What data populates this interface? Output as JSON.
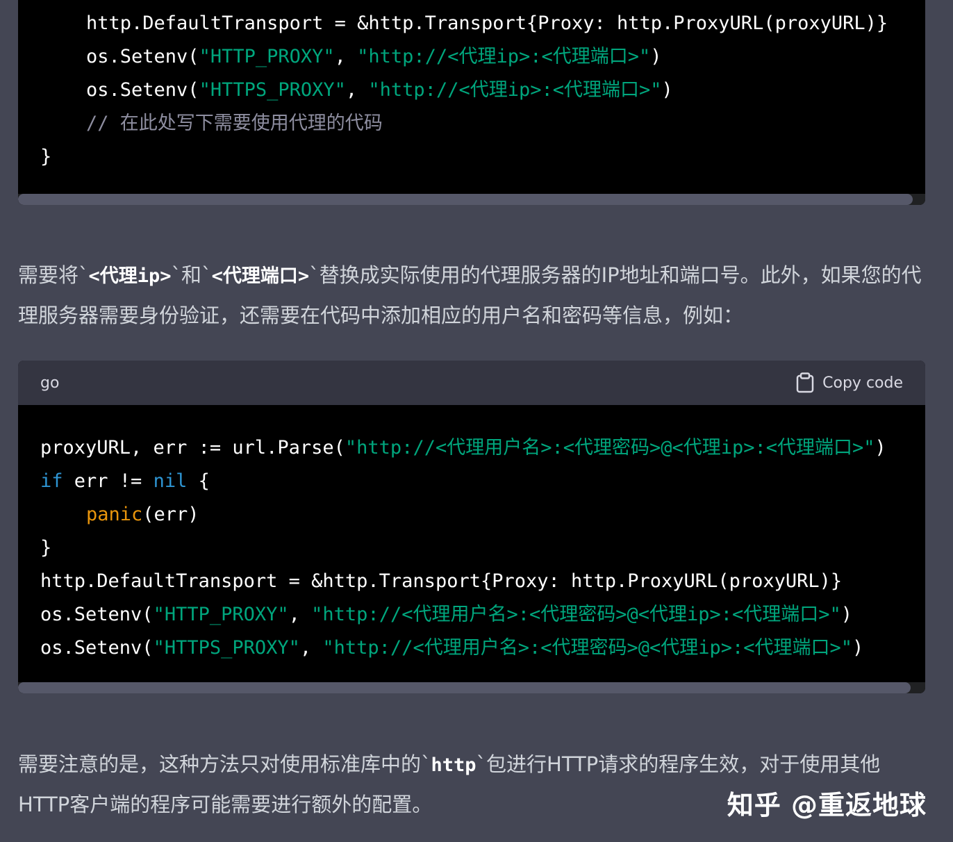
{
  "code_block_1": {
    "lines": [
      {
        "indent": true,
        "tokens": [
          {
            "t": "http.DefaultTransport = &http.Transport{Proxy: http.ProxyURL(proxyURL)}",
            "c": ""
          }
        ]
      },
      {
        "indent": true,
        "tokens": [
          {
            "t": "os.Setenv(",
            "c": ""
          },
          {
            "t": "\"HTTP_PROXY\"",
            "c": "str"
          },
          {
            "t": ", ",
            "c": ""
          },
          {
            "t": "\"http://<代理ip>:<代理端口>\"",
            "c": "str"
          },
          {
            "t": ")",
            "c": ""
          }
        ]
      },
      {
        "indent": true,
        "tokens": [
          {
            "t": "os.Setenv(",
            "c": ""
          },
          {
            "t": "\"HTTPS_PROXY\"",
            "c": "str"
          },
          {
            "t": ", ",
            "c": ""
          },
          {
            "t": "\"http://<代理ip>:<代理端口>\"",
            "c": "str"
          },
          {
            "t": ")",
            "c": ""
          }
        ]
      },
      {
        "indent": true,
        "tokens": [
          {
            "t": "// 在此处写下需要使用代理的代码",
            "c": "cm"
          }
        ]
      },
      {
        "indent": false,
        "tokens": [
          {
            "t": "}",
            "c": ""
          }
        ]
      }
    ]
  },
  "paragraph_1": {
    "before": "需要将`",
    "code_a": "<代理ip>",
    "mid": "`和`",
    "code_b": "<代理端口>",
    "after": "`替换成实际使用的代理服务器的IP地址和端口号。此外，如果您的代理服务器需要身份验证，还需要在代码中添加相应的用户名和密码等信息，例如："
  },
  "code_block_2": {
    "language": "go",
    "copy_label": "Copy code",
    "lines": [
      {
        "indent": false,
        "tokens": [
          {
            "t": "proxyURL, err := url.Parse(",
            "c": ""
          },
          {
            "t": "\"http://<代理用户名>:<代理密码>@<代理ip>:<代理端口>\"",
            "c": "str"
          },
          {
            "t": ")",
            "c": ""
          }
        ]
      },
      {
        "indent": false,
        "tokens": [
          {
            "t": "if",
            "c": "kw"
          },
          {
            "t": " err != ",
            "c": ""
          },
          {
            "t": "nil",
            "c": "kw"
          },
          {
            "t": " {",
            "c": ""
          }
        ]
      },
      {
        "indent": true,
        "tokens": [
          {
            "t": "panic",
            "c": "fn"
          },
          {
            "t": "(err)",
            "c": ""
          }
        ]
      },
      {
        "indent": false,
        "tokens": [
          {
            "t": "}",
            "c": ""
          }
        ]
      },
      {
        "indent": false,
        "tokens": [
          {
            "t": "http.DefaultTransport = &http.Transport{Proxy: http.ProxyURL(proxyURL)}",
            "c": ""
          }
        ]
      },
      {
        "indent": false,
        "tokens": [
          {
            "t": "os.Setenv(",
            "c": ""
          },
          {
            "t": "\"HTTP_PROXY\"",
            "c": "str"
          },
          {
            "t": ", ",
            "c": ""
          },
          {
            "t": "\"http://<代理用户名>:<代理密码>@<代理ip>:<代理端口>\"",
            "c": "str"
          },
          {
            "t": ")",
            "c": ""
          }
        ]
      },
      {
        "indent": false,
        "tokens": [
          {
            "t": "os.Setenv(",
            "c": ""
          },
          {
            "t": "\"HTTPS_PROXY\"",
            "c": "str"
          },
          {
            "t": ", ",
            "c": ""
          },
          {
            "t": "\"http://<代理用户名>:<代理密码>@<代理ip>:<代理端口>\"",
            "c": "str"
          },
          {
            "t": ")",
            "c": ""
          }
        ]
      }
    ]
  },
  "paragraph_2": {
    "before": "需要注意的是，这种方法只对使用标准库中的`",
    "code": "http",
    "after": "`包进行HTTP请求的程序生效，对于使用其他HTTP客户端的程序可能需要进行额外的配置。"
  },
  "watermark": "知乎 @重返地球",
  "icons": {
    "copy": "clipboard-icon"
  },
  "colors": {
    "page_bg": "#444654",
    "code_bg": "#000000",
    "header_bg": "#343541",
    "string": "#00a67d",
    "keyword": "#2e95d3",
    "function": "#e9950c",
    "comment": "#8e8ea0"
  }
}
